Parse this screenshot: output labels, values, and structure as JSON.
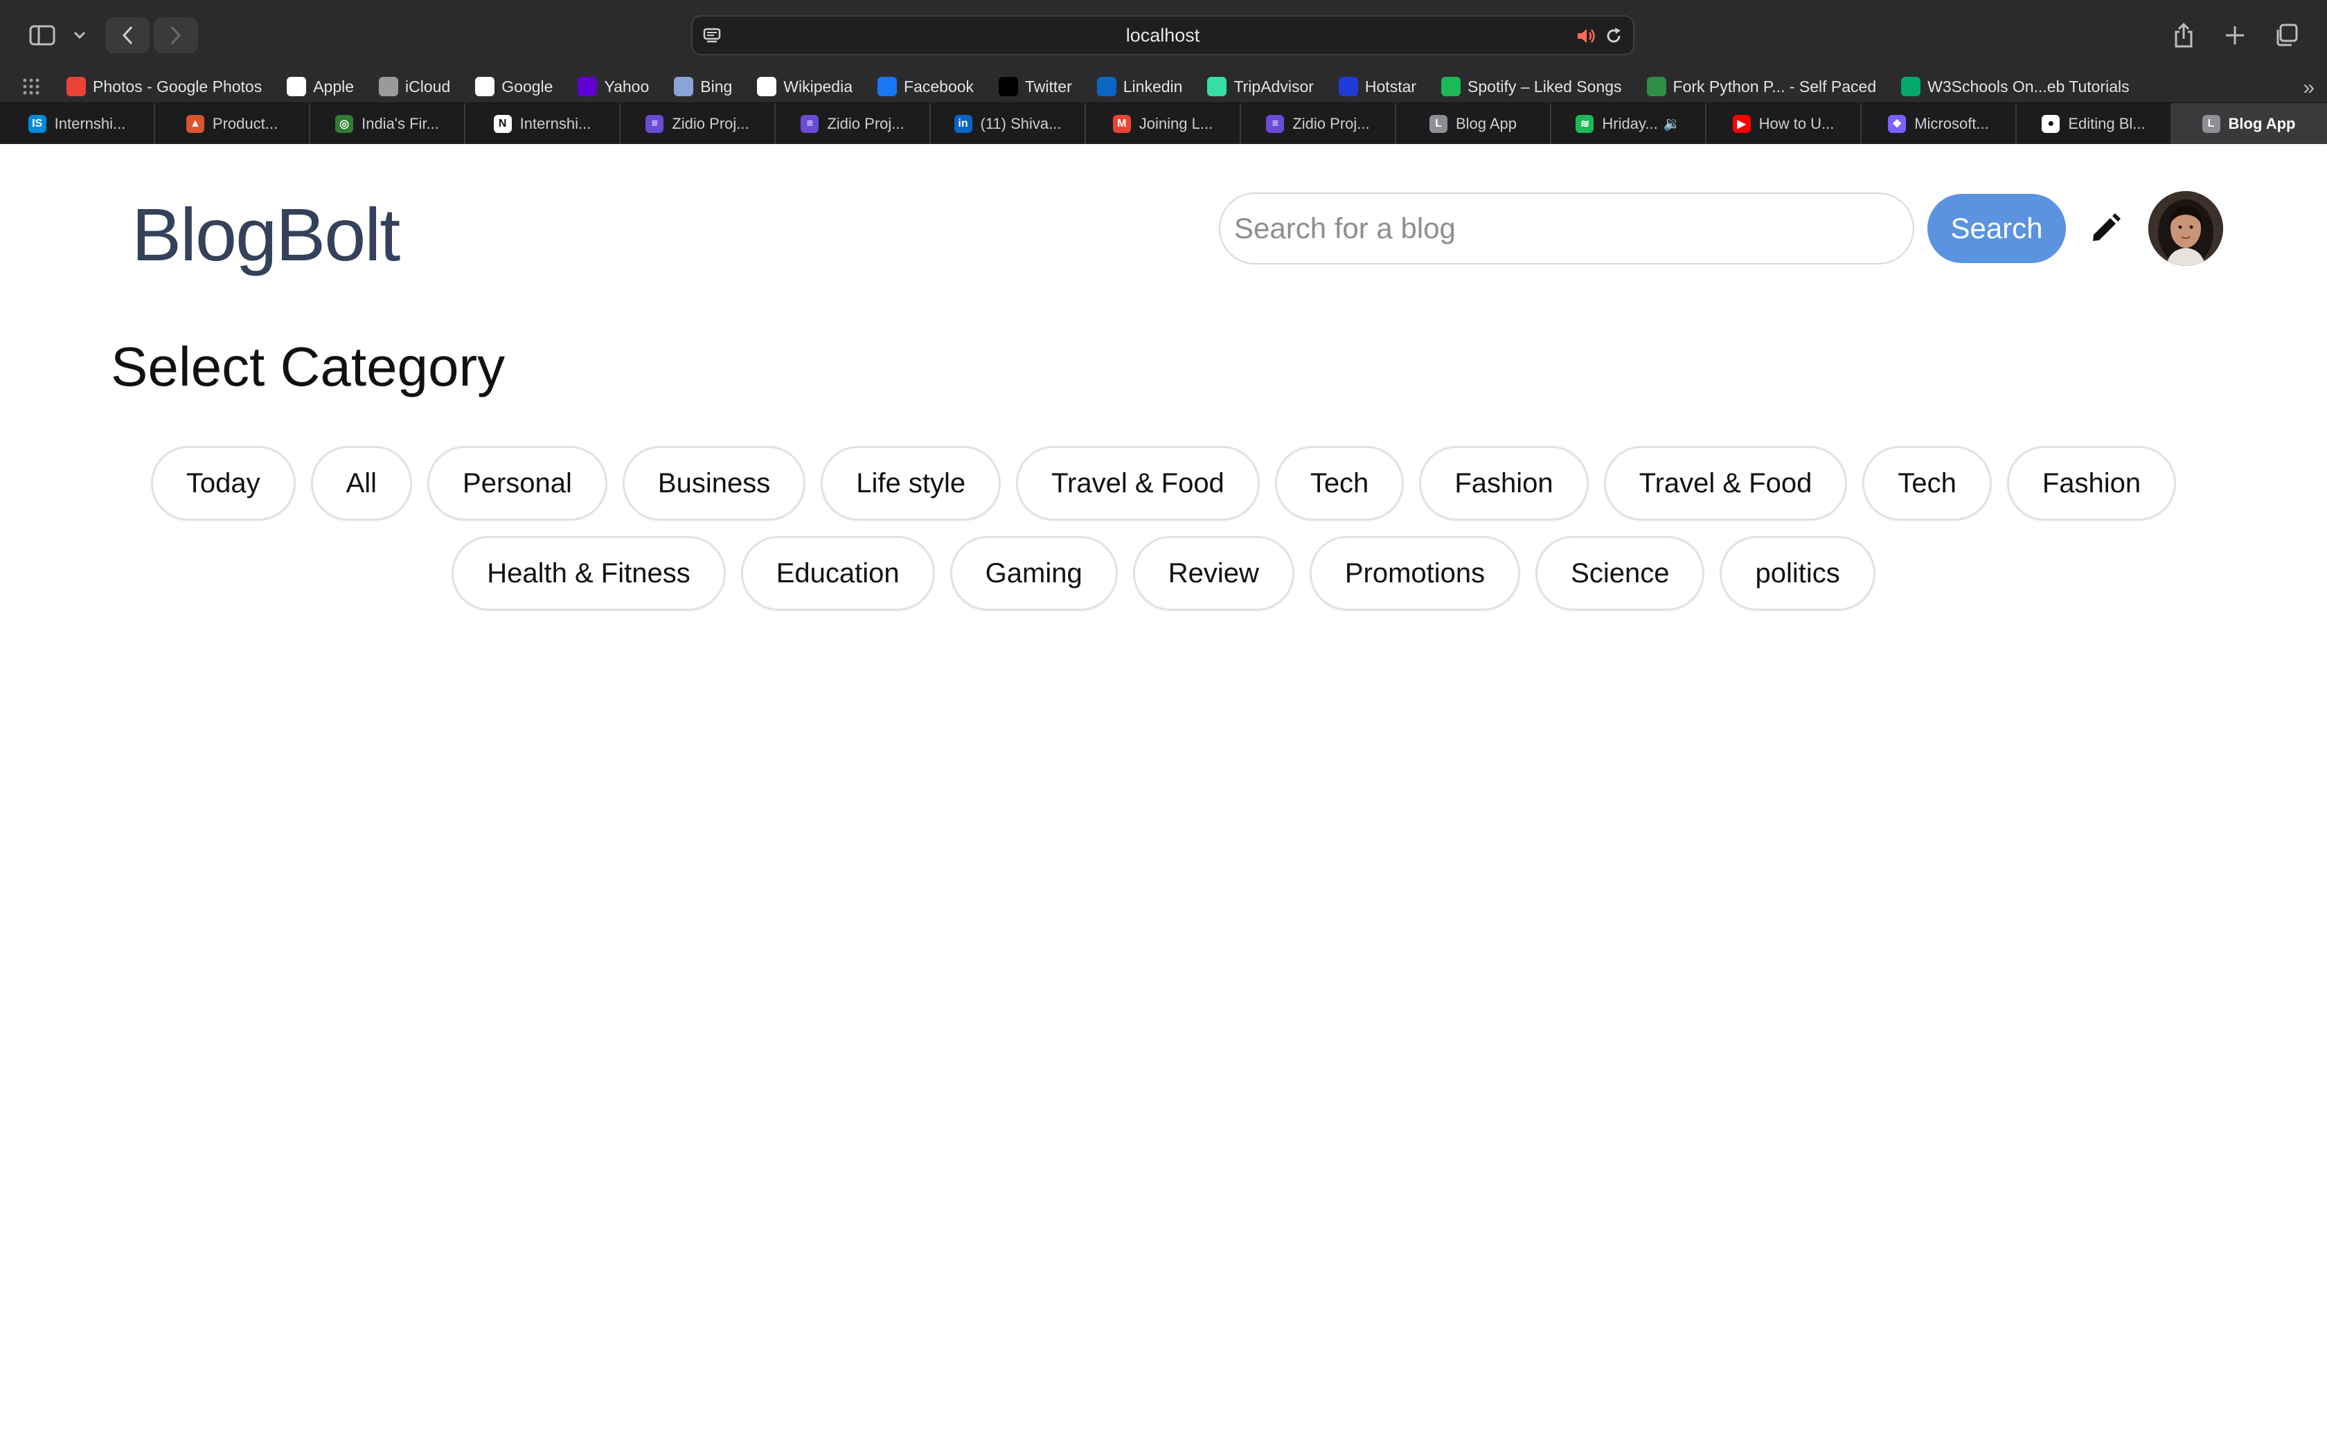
{
  "browser": {
    "url": "localhost",
    "bookmarks": [
      {
        "label": "Photos - Google Photos",
        "icon": "google-photos-icon",
        "color": "#ea4335"
      },
      {
        "label": "Apple",
        "icon": "apple-icon",
        "color": "#ffffff"
      },
      {
        "label": "iCloud",
        "icon": "apple-icon",
        "color": "#9a9a9a"
      },
      {
        "label": "Google",
        "icon": "google-icon",
        "color": "#ffffff"
      },
      {
        "label": "Yahoo",
        "icon": "yahoo-icon",
        "color": "#6001d2"
      },
      {
        "label": "Bing",
        "icon": "bing-icon",
        "color": "#8aa4d6"
      },
      {
        "label": "Wikipedia",
        "icon": "wikipedia-icon",
        "color": "#ffffff"
      },
      {
        "label": "Facebook",
        "icon": "facebook-icon",
        "color": "#1877f2"
      },
      {
        "label": "Twitter",
        "icon": "x-icon",
        "color": "#000000"
      },
      {
        "label": "Linkedin",
        "icon": "linkedin-icon",
        "color": "#0a66c2"
      },
      {
        "label": "TripAdvisor",
        "icon": "tripadvisor-icon",
        "color": "#34e0a1"
      },
      {
        "label": "Hotstar",
        "icon": "hotstar-icon",
        "color": "#1f3bd6"
      },
      {
        "label": "Spotify – Liked Songs",
        "icon": "spotify-icon",
        "color": "#1db954"
      },
      {
        "label": "Fork Python P... - Self Paced",
        "icon": "gfg-icon",
        "color": "#2f8d46"
      },
      {
        "label": "W3Schools On...eb Tutorials",
        "icon": "w3schools-icon",
        "color": "#04aa6d"
      }
    ],
    "tabs": [
      {
        "label": "Internshi...",
        "icon": "internshala-icon",
        "color": "#008bdc",
        "glyph": "IS"
      },
      {
        "label": "Product...",
        "icon": "producthunt-icon",
        "color": "#da552f",
        "glyph": "▲"
      },
      {
        "label": "India's Fir...",
        "icon": "site-icon",
        "color": "#2e7d32",
        "glyph": "◎"
      },
      {
        "label": "Internshi...",
        "icon": "notion-icon",
        "color": "#ffffff",
        "glyph": "N"
      },
      {
        "label": "Zidio Proj...",
        "icon": "zidio-icon",
        "color": "#6a4bd6",
        "glyph": "≡"
      },
      {
        "label": "Zidio Proj...",
        "icon": "zidio-icon",
        "color": "#6a4bd6",
        "glyph": "≡"
      },
      {
        "label": "(11) Shiva...",
        "icon": "linkedin-icon",
        "color": "#0a66c2",
        "glyph": "in"
      },
      {
        "label": "Joining L...",
        "icon": "gmail-icon",
        "color": "#ea4335",
        "glyph": "M"
      },
      {
        "label": "Zidio Proj...",
        "icon": "zidio-icon",
        "color": "#6a4bd6",
        "glyph": "≡"
      },
      {
        "label": "Blog App",
        "icon": "blog-app-icon",
        "color": "#8e8e93",
        "glyph": "L"
      },
      {
        "label": "Hriday...",
        "icon": "spotify-icon",
        "color": "#1db954",
        "glyph": "≋",
        "sound": true
      },
      {
        "label": "How to U...",
        "icon": "youtube-icon",
        "color": "#ff0000",
        "glyph": "▶"
      },
      {
        "label": "Microsoft...",
        "icon": "microsoft-copilot-icon",
        "color": "#7b61ff",
        "glyph": "❖"
      },
      {
        "label": "Editing Bl...",
        "icon": "github-icon",
        "color": "#ffffff",
        "glyph": "●"
      },
      {
        "label": "Blog App",
        "icon": "blog-app-icon",
        "color": "#8e8e93",
        "glyph": "L",
        "active": true
      }
    ]
  },
  "header": {
    "brand": "BlogBolt",
    "search_placeholder": "Search for a blog",
    "search_button": "Search"
  },
  "main": {
    "section_title": "Select Category",
    "categories": [
      "Today",
      "All",
      "Personal",
      "Business",
      "Life style",
      "Travel & Food",
      "Tech",
      "Fashion",
      "Travel & Food",
      "Tech",
      "Fashion",
      "Health & Fitness",
      "Education",
      "Gaming",
      "Review",
      "Promotions",
      "Science",
      "politics"
    ]
  },
  "colors": {
    "accent": "#5b93e0",
    "brand_text": "#34415a"
  }
}
